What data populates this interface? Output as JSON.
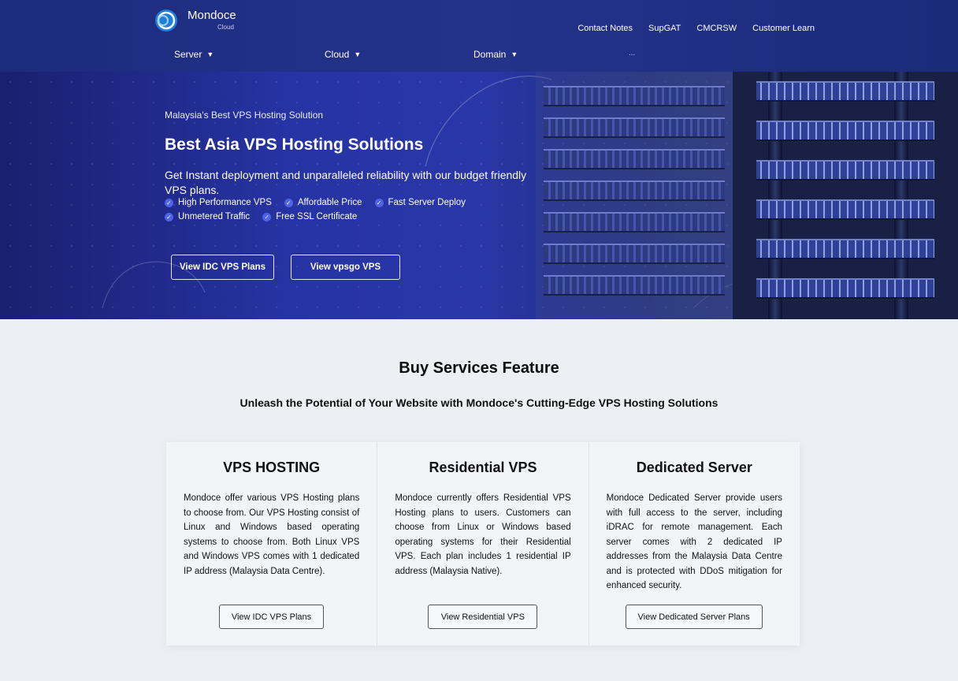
{
  "header": {
    "brand": "Mondoce",
    "brand_sub": "Cloud",
    "top_links": [
      "Contact Notes",
      "SupGAT",
      "CMCRSW",
      "Customer Learn"
    ],
    "nav": [
      {
        "label": "Server",
        "icon": "chevron-down-icon"
      },
      {
        "label": "Cloud",
        "icon": "chevron-down-icon"
      },
      {
        "label": "Domain",
        "icon": "chevron-down-icon"
      }
    ],
    "nav_more": "..."
  },
  "hero": {
    "pretitle": "Malaysia's Best VPS Hosting Solution",
    "title": "Best Asia VPS Hosting Solutions",
    "description": "Get Instant deployment and unparalleled reliability with our budget friendly VPS plans.",
    "features": [
      "High Performance VPS",
      "Affordable Price",
      "Fast Server Deploy",
      "Unmetered Traffic",
      "Free SSL Certificate"
    ],
    "buttons": [
      "View IDC VPS Plans",
      "View vpsgo VPS"
    ]
  },
  "section": {
    "title": "Buy Services Feature",
    "subtitle": "Unleash the Potential of Your Website with Mondoce's Cutting-Edge VPS Hosting Solutions"
  },
  "cards": [
    {
      "title": "VPS HOSTING",
      "text": "Mondoce offer various VPS Hosting plans to choose from. Our VPS Hosting consist of Linux and Windows based operating systems to choose from. Both Linux VPS and Windows VPS comes with 1 dedicated IP address (Malaysia Data Centre).",
      "button": "View IDC VPS Plans"
    },
    {
      "title": "Residential VPS",
      "text": "Mondoce currently offers Residential VPS Hosting plans to users. Customers can choose from Linux or Windows based operating systems for their Residential VPS. Each plan includes 1 residential IP address (Malaysia Native).",
      "button": "View Residential VPS"
    },
    {
      "title": "Dedicated Server",
      "text": "Mondoce Dedicated Server provide users with full access to the server, including iDRAC for remote management. Each server comes with 2 dedicated IP addresses from the Malaysia Data Centre and is protected with DDoS mitigation for enhanced security.",
      "button": "View Dedicated Server Plans"
    }
  ],
  "colors": {
    "header_bg": "#1f2d82",
    "hero_accent": "#2a37a8",
    "check_icon": "#4f63e6",
    "page_bg": "#eceff4"
  }
}
